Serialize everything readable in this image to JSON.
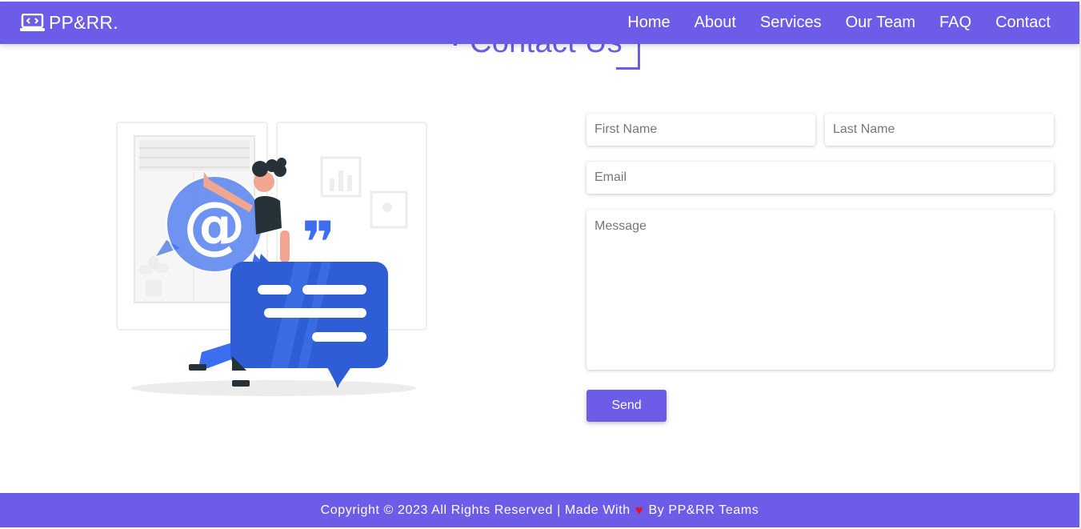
{
  "brand": {
    "name": "PP&RR."
  },
  "nav": {
    "items": [
      {
        "label": "Home"
      },
      {
        "label": "About"
      },
      {
        "label": "Services"
      },
      {
        "label": "Our Team"
      },
      {
        "label": "FAQ"
      },
      {
        "label": "Contact"
      }
    ]
  },
  "page": {
    "heading": "Contact Us"
  },
  "illustration": {
    "at_symbol": "@",
    "quote_mark": "❞"
  },
  "form": {
    "first_name_placeholder": "First Name",
    "last_name_placeholder": "Last Name",
    "email_placeholder": "Email",
    "message_placeholder": "Message",
    "send_label": "Send"
  },
  "footer": {
    "text_before": "Copyright © 2023 All Rights Reserved | Made With",
    "heart": "♥",
    "text_after": "By PP&RR Teams"
  },
  "colors": {
    "accent": "#6c5ce7",
    "heart": "#e8112d",
    "illustration_blue": "#3b6ef0"
  }
}
